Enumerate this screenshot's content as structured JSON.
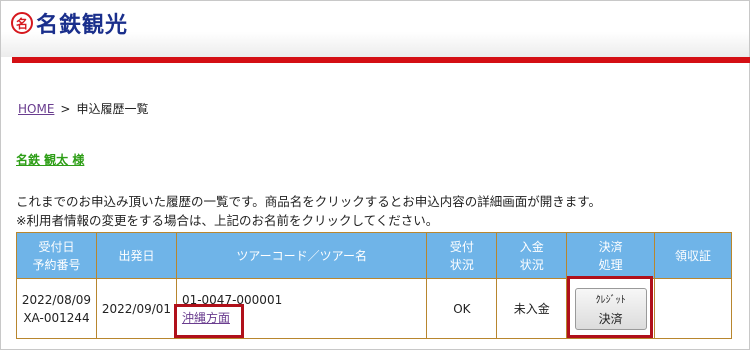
{
  "brand": {
    "logo_mark": "名",
    "name": "名鉄観光",
    "accent_color": "#d40f14",
    "brand_color": "#1a2f8c"
  },
  "breadcrumb": {
    "home": "HOME",
    "separator": ">",
    "current": "申込履歴一覧"
  },
  "user": {
    "name": "名鉄 観太 様"
  },
  "description": {
    "line1": "これまでのお申込み頂いた履歴の一覧です。商品名をクリックするとお申込内容の詳細画面が開きます。",
    "line2": "※利用者情報の変更をする場合は、上記のお名前をクリックしてください。"
  },
  "table": {
    "headers": {
      "accept_date": "受付日",
      "booking_no": "予約番号",
      "departure": "出発日",
      "tour": "ツアーコード／ツアー名",
      "accept_status_1": "受付",
      "accept_status_2": "状況",
      "payment_status_1": "入金",
      "payment_status_2": "状況",
      "settlement_1": "決済",
      "settlement_2": "処理",
      "receipt": "領収証"
    },
    "rows": [
      {
        "accept_date": "2022/08/09",
        "booking_no": "XA-001244",
        "departure": "2022/09/01",
        "tour_code": "01-0047-000001",
        "tour_name": "沖縄方面",
        "accept_status": "OK",
        "payment_status": "未入金",
        "credit_button_line1": "ｸﾚｼﾞｯﾄ",
        "credit_button_line2": "決済",
        "receipt": ""
      }
    ]
  }
}
